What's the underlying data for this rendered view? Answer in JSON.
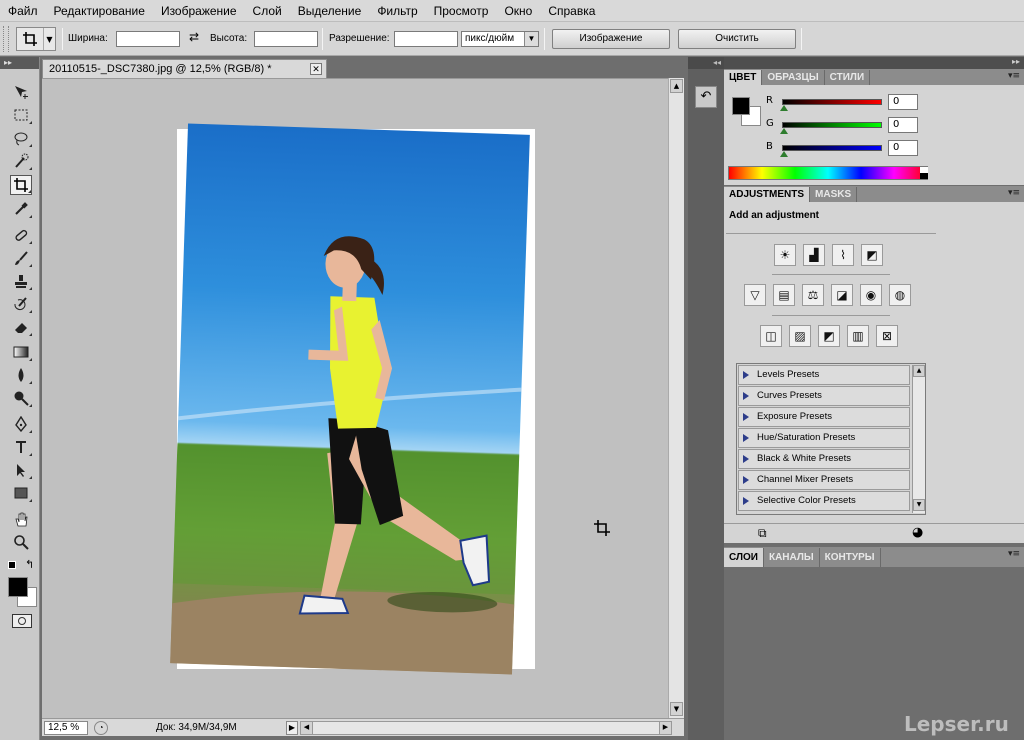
{
  "menu": [
    "Файл",
    "Редактирование",
    "Изображение",
    "Слой",
    "Выделение",
    "Фильтр",
    "Просмотр",
    "Окно",
    "Справка"
  ],
  "options": {
    "width_label": "Ширина:",
    "height_label": "Высота:",
    "resolution_label": "Разрешение:",
    "unit": "пикс/дюйм",
    "image_button": "Изображение",
    "clear_button": "Очистить"
  },
  "document": {
    "tab_title": "20110515-_DSC7380.jpg @ 12,5% (RGB/8) *",
    "zoom": "12,5 %",
    "doc_size": "Док: 34,9M/34,9M"
  },
  "color_panel": {
    "tabs": [
      "ЦВЕТ",
      "ОБРАЗЦЫ",
      "СТИЛИ"
    ],
    "r_label": "R",
    "g_label": "G",
    "b_label": "B",
    "r": "0",
    "g": "0",
    "b": "0"
  },
  "adjustments": {
    "tabs": [
      "ADJUSTMENTS",
      "MASKS"
    ],
    "title": "Add an adjustment",
    "presets": [
      "Levels Presets",
      "Curves Presets",
      "Exposure Presets",
      "Hue/Saturation Presets",
      "Black & White Presets",
      "Channel Mixer Presets",
      "Selective Color Presets"
    ]
  },
  "layers_panel": {
    "tabs": [
      "СЛОИ",
      "КАНАЛЫ",
      "КОНТУРЫ"
    ]
  },
  "watermark": "Lepser.ru",
  "tools": [
    "move-tool-icon",
    "marquee-tool-icon",
    "lasso-tool-icon",
    "quick-selection-icon",
    "crop-tool-icon",
    "eyedropper-icon",
    "healing-brush-icon",
    "brush-icon",
    "clone-stamp-icon",
    "history-brush-icon",
    "eraser-icon",
    "gradient-icon",
    "blur-icon",
    "dodge-icon",
    "pen-icon",
    "type-icon",
    "path-selection-icon",
    "shape-icon",
    "hand-icon",
    "zoom-icon"
  ],
  "colors": {
    "foreground": "#000000",
    "background": "#ffffff",
    "sky": "#1a6ec8",
    "grass": "#5c9a32"
  }
}
